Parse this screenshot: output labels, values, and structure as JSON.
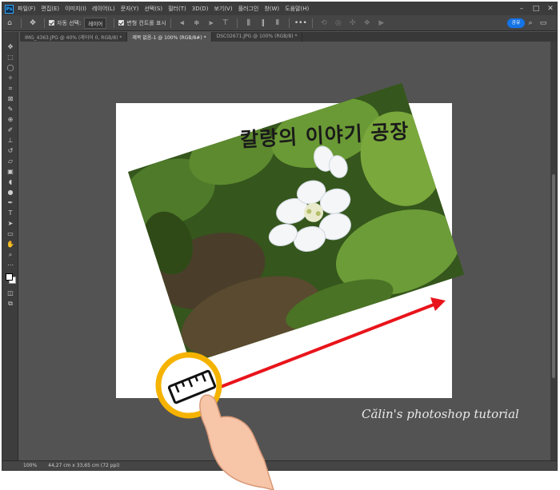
{
  "titlebar": {
    "logo": "Ps",
    "menu": [
      "파일(F)",
      "편집(E)",
      "이미지(I)",
      "레이어(L)",
      "문자(Y)",
      "선택(S)",
      "필터(T)",
      "3D(D)",
      "보기(V)",
      "플러그인",
      "창(W)",
      "도움말(H)"
    ],
    "controls": [
      "–",
      "□",
      "✕"
    ]
  },
  "options": {
    "auto_select_label": "자동 선택:",
    "layer_dropdown": "레이어",
    "show_transform_label": "변형 컨트롤 표시",
    "share_label": "공유"
  },
  "tabs": [
    {
      "label": "IMG_4363.JPG @ 40% (레이어 0, RGB/8) *"
    },
    {
      "label": "제목 없음-1 @ 100% (RGB/8#) *"
    },
    {
      "label": "DSC02671.JPG @ 100% (RGB/8) *"
    }
  ],
  "tools": [
    "move-tool",
    "marquee-tool",
    "lasso-tool",
    "magic-wand-tool",
    "crop-tool",
    "frame-tool",
    "eyedropper-tool",
    "healing-tool",
    "brush-tool",
    "stamp-tool",
    "history-brush-tool",
    "eraser-tool",
    "gradient-tool",
    "blur-tool",
    "dodge-tool",
    "pen-tool",
    "type-tool",
    "path-select-tool",
    "shape-tool",
    "hand-tool",
    "zoom-tool",
    "more-tools"
  ],
  "canvas": {
    "title_text": "칼랑의 이야기 공장",
    "caption": "Călin's photoshop tutorial"
  },
  "status": {
    "zoom": "100%",
    "doc_info": "44,27 cm x 33,65 cm (72 ppi)"
  },
  "colors": {
    "arrow": "#e8141b",
    "ring": "#f5b300"
  }
}
